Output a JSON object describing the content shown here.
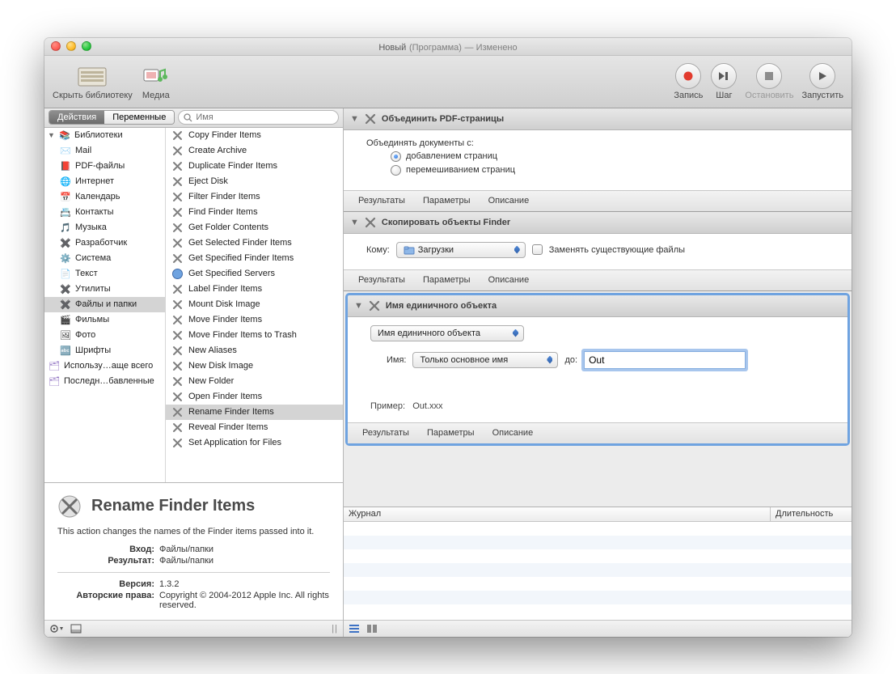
{
  "title": {
    "main": "Новый",
    "paren": "(Программа)",
    "dash": " — ",
    "mod": "Изменено"
  },
  "toolbar": {
    "hideLib": "Скрыть библиотеку",
    "media": "Медиа",
    "record": "Запись",
    "step": "Шаг",
    "stop": "Остановить",
    "run": "Запустить"
  },
  "filter": {
    "tab_actions": "Действия",
    "tab_vars": "Переменные",
    "search_placeholder": "Имя"
  },
  "tree": {
    "root": "Библиотеки",
    "items": [
      "Mail",
      "PDF-файлы",
      "Интернет",
      "Календарь",
      "Контакты",
      "Музыка",
      "Разработчик",
      "Система",
      "Текст",
      "Утилиты",
      "Файлы и папки",
      "Фильмы",
      "Фото",
      "Шрифты"
    ],
    "recent1": "Использу…аще всего",
    "recent2": "Последн…бавленные",
    "selected": "Файлы и папки"
  },
  "actions": {
    "items": [
      "Copy Finder Items",
      "Create Archive",
      "Duplicate Finder Items",
      "Eject Disk",
      "Filter Finder Items",
      "Find Finder Items",
      "Get Folder Contents",
      "Get Selected Finder Items",
      "Get Specified Finder Items",
      "Get Specified Servers",
      "Label Finder Items",
      "Mount Disk Image",
      "Move Finder Items",
      "Move Finder Items to Trash",
      "New Aliases",
      "New Disk Image",
      "New Folder",
      "Open Finder Items",
      "Rename Finder Items",
      "Reveal Finder Items",
      "Set Application for Files"
    ],
    "selected": "Rename Finder Items"
  },
  "info": {
    "title": "Rename Finder Items",
    "desc": "This action changes the names of the Finder items passed into it.",
    "k_input": "Вход:",
    "v_input": "Файлы/папки",
    "k_result": "Результат:",
    "v_result": "Файлы/папки",
    "k_version": "Версия:",
    "v_version": "1.3.2",
    "k_copy": "Авторские права:",
    "v_copy": "Copyright © 2004-2012 Apple Inc.  All rights reserved."
  },
  "wf": {
    "footer_results": "Результаты",
    "footer_params": "Параметры",
    "footer_desc": "Описание",
    "a1": {
      "title": "Объединить PDF-страницы",
      "label": "Объединять документы с:",
      "opt1": "добавлением страниц",
      "opt2": "перемешиванием страниц"
    },
    "a2": {
      "title": "Скопировать объекты Finder",
      "to_label": "Кому:",
      "dest": "Загрузки",
      "replace": "Заменять существующие файлы"
    },
    "a3": {
      "title": "Имя единичного объекта",
      "mode": "Имя единичного объекта",
      "name_label": "Имя:",
      "name_mode": "Только основное имя",
      "to_label": "до:",
      "value": "Out",
      "example_k": "Пример:",
      "example_v": "Out.xxx"
    }
  },
  "journal": {
    "col1": "Журнал",
    "col2": "Длительность"
  }
}
